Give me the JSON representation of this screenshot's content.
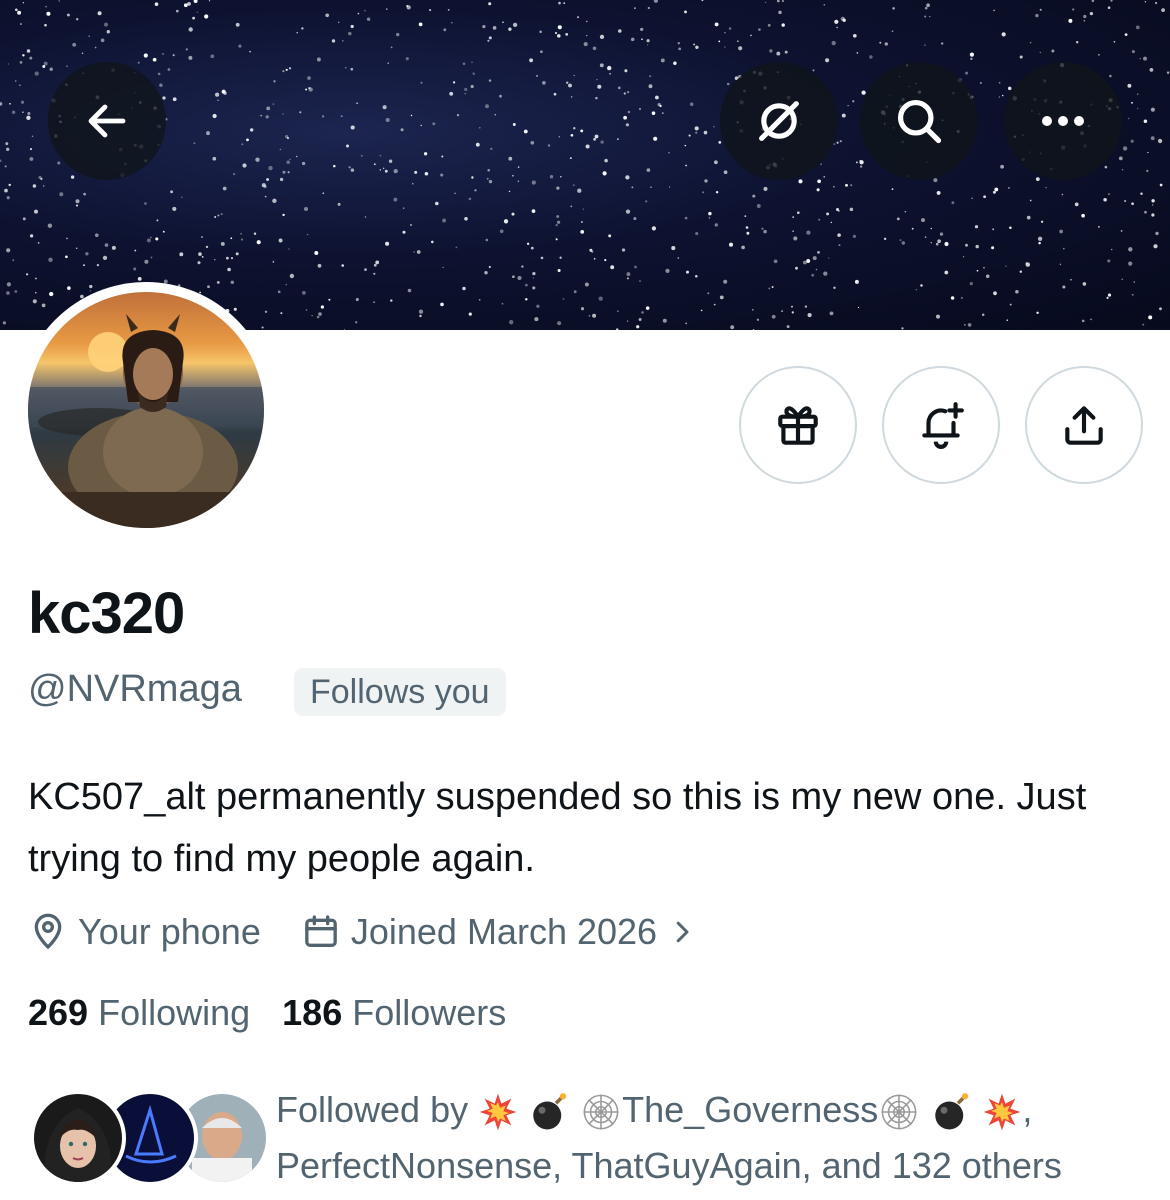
{
  "header": {
    "back_icon": "arrow-left-icon",
    "grok_icon": "grok-slash-icon",
    "search_icon": "search-icon",
    "more_icon": "more-horizontal-icon"
  },
  "actions": {
    "gift_icon": "gift-icon",
    "notify_icon": "bell-plus-icon",
    "share_icon": "share-icon"
  },
  "profile": {
    "display_name": "kc320",
    "handle": "@NVRmaga",
    "follows_you": "Follows you",
    "bio": "KC507_alt permanently suspended so this is my new one. Just trying to find my people again.",
    "location": "Your phone",
    "joined": "Joined March 2026",
    "following_count": "269",
    "following_label": "Following",
    "followers_count": "186",
    "followers_label": "Followers"
  },
  "followed_by": {
    "prefix": "Followed by",
    "name1": "The_Governess",
    "rest": ", PerfectNonsense, ThatGuyAgain, and 132 others"
  },
  "colors": {
    "text_primary": "#0f1419",
    "text_secondary": "#536471",
    "badge_bg": "#eff3f4",
    "border": "#cfd9de"
  }
}
